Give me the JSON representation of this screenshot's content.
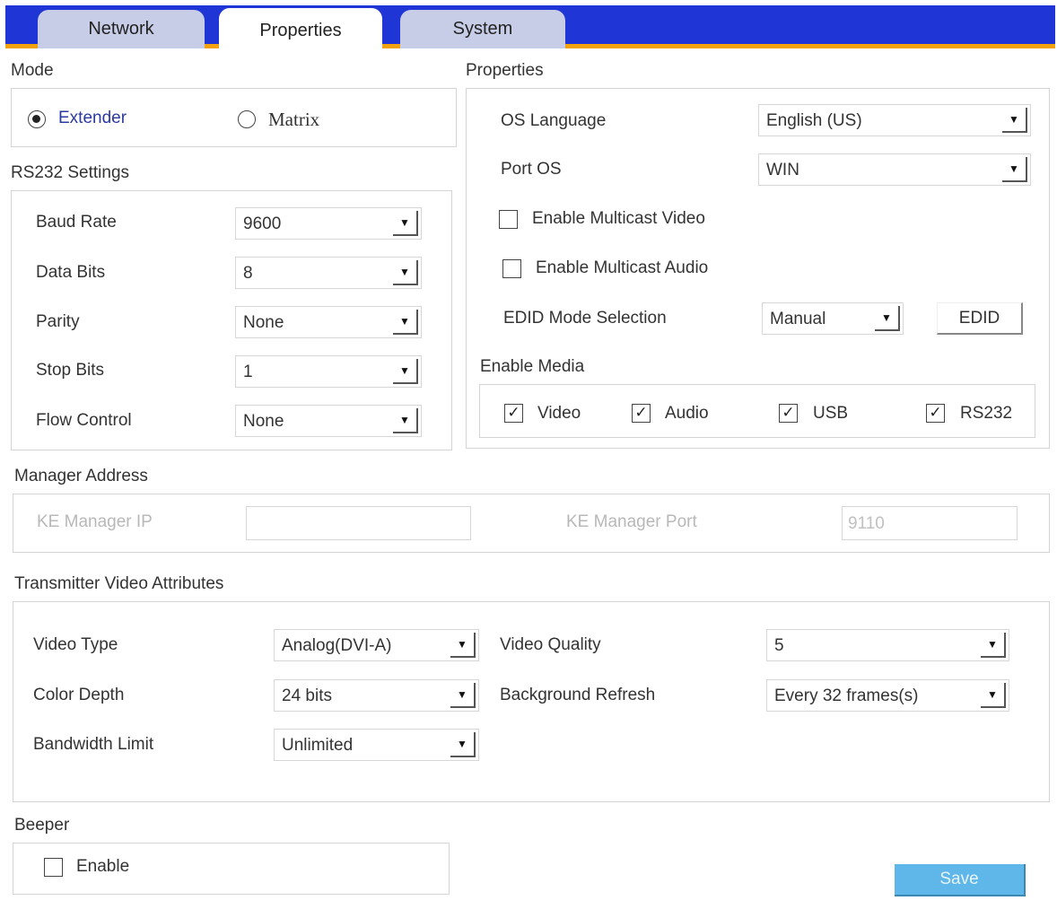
{
  "tabs": [
    {
      "label": "Network"
    },
    {
      "label": "Properties"
    },
    {
      "label": "System"
    }
  ],
  "mode": {
    "title": "Mode",
    "options": [
      {
        "label": "Extender",
        "selected": true
      },
      {
        "label": "Matrix",
        "selected": false
      }
    ]
  },
  "rs232": {
    "title": "RS232 Settings",
    "fields": [
      {
        "label": "Baud Rate",
        "value": "9600"
      },
      {
        "label": "Data Bits",
        "value": "8"
      },
      {
        "label": "Parity",
        "value": "None"
      },
      {
        "label": "Stop Bits",
        "value": "1"
      },
      {
        "label": "Flow Control",
        "value": "None"
      }
    ]
  },
  "properties": {
    "title": "Properties",
    "os_language": {
      "label": "OS Language",
      "value": "English (US)"
    },
    "port_os": {
      "label": "Port OS",
      "value": "WIN"
    },
    "multicast_video": {
      "label": "Enable Multicast Video",
      "checked": false
    },
    "multicast_audio": {
      "label": "Enable Multicast Audio",
      "checked": false
    },
    "edid_mode": {
      "label": "EDID Mode Selection",
      "value": "Manual"
    },
    "edid_button": "EDID"
  },
  "enable_media": {
    "title": "Enable Media",
    "items": [
      {
        "label": "Video",
        "checked": true
      },
      {
        "label": "Audio",
        "checked": true
      },
      {
        "label": "USB",
        "checked": true
      },
      {
        "label": "RS232",
        "checked": true
      }
    ]
  },
  "manager_address": {
    "title": "Manager Address",
    "ip_label": "KE Manager IP",
    "ip_value": "",
    "port_label": "KE Manager Port",
    "port_value": "9110"
  },
  "video_attributes": {
    "title": "Transmitter Video Attributes",
    "video_type": {
      "label": "Video Type",
      "value": "Analog(DVI-A)"
    },
    "color_depth": {
      "label": "Color Depth",
      "value": "24 bits"
    },
    "bandwidth_limit": {
      "label": "Bandwidth Limit",
      "value": "Unlimited"
    },
    "video_quality": {
      "label": "Video Quality",
      "value": "5"
    },
    "background_refresh": {
      "label": "Background Refresh",
      "value": "Every 32 frames(s)"
    }
  },
  "beeper": {
    "title": "Beeper",
    "enable_label": "Enable",
    "enabled": false
  },
  "save_label": "Save"
}
